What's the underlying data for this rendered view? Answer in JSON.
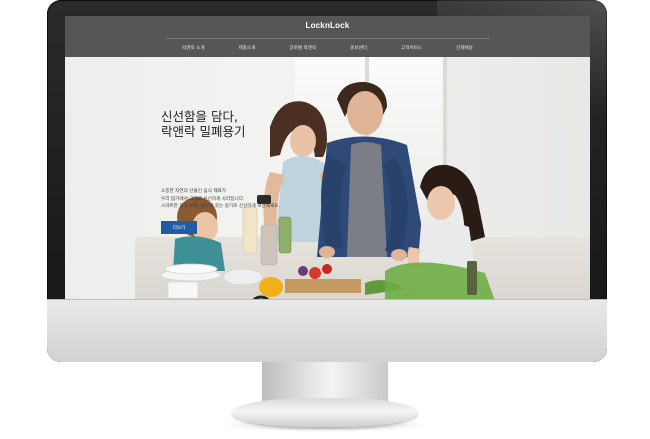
{
  "site": {
    "logo": "LocknLock",
    "nav": [
      "락앤락 소개",
      "제품소개",
      "글로벌 락앤락",
      "홍보센터",
      "고객서비스",
      "인재채용"
    ]
  },
  "hero": {
    "headline_lines": [
      "신선함을 담다,",
      "락앤락 밀폐용기"
    ],
    "description_lines": [
      "소중한 자연의 선물인 음식 재료가",
      "우리 땀가에서 그대로 신선하게 사라집니다.",
      "스마트한 음식 보관, 원두의 갖는 용기로 신선하게 보관해세요."
    ],
    "more_button": "더보기"
  },
  "colors": {
    "header_bg": "#565656",
    "button_bg": "#1f5ca4",
    "bezel": "#1b1b1b",
    "chin": "#dcdcdc"
  }
}
